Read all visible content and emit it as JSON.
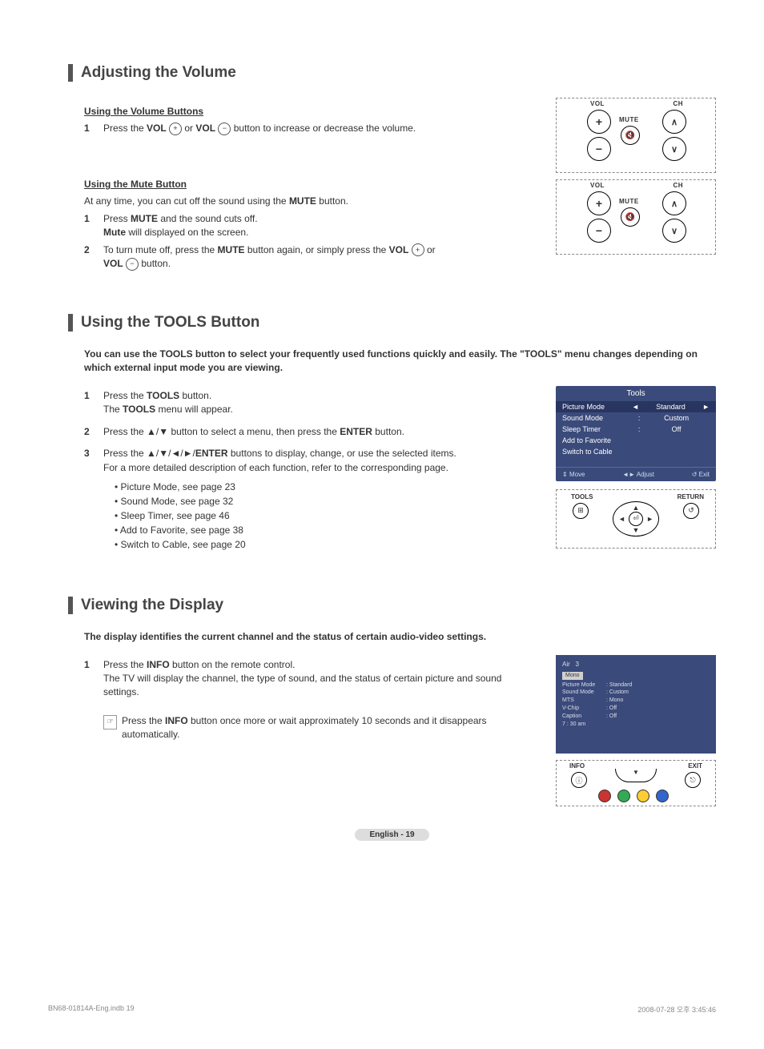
{
  "section1": {
    "title": "Adjusting the Volume",
    "sub1": "Using the Volume Buttons",
    "step1_pre": "Press the ",
    "vol": "VOL",
    "step1_mid": " or ",
    "step1_post": " button to increase or decrease the volume.",
    "sub2": "Using the Mute Button",
    "sub2_intro_pre": "At any time, you can cut off the sound using the ",
    "mute": "MUTE",
    "sub2_intro_post": " button.",
    "step2a_pre": "Press ",
    "step2a_mid": " and the sound cuts off.",
    "step2a_note_pre": "",
    "mute_cap": "Mute",
    "step2a_note_post": " will displayed on the screen.",
    "step2b_pre": "To turn mute off, press the ",
    "step2b_mid": " button again, or simply press the ",
    "step2b_or": " or ",
    "step2b_post": " button.",
    "remote": {
      "vol": "VOL",
      "ch": "CH",
      "mute": "MUTE"
    }
  },
  "section2": {
    "title": "Using the TOOLS Button",
    "intro": "You can use the TOOLS button to select your frequently used functions quickly and easily. The \"TOOLS\" menu changes depending on which external input mode you are viewing.",
    "step1_pre": "Press the ",
    "tools": "TOOLS",
    "step1_post": " button.",
    "step1_line2_pre": "The ",
    "step1_line2_post": " menu will appear.",
    "step2": "Press the ▲/▼ button to select a menu, then press the ",
    "enter": "ENTER",
    "step2_post": " button.",
    "step3_pre": "Press the ▲/▼/◄/►/",
    "step3_post": " buttons to display, change, or use the selected items.",
    "step3_line2": "For a more detailed description of each function, refer to the corresponding page.",
    "bullets": [
      "• Picture Mode, see page 23",
      "• Sound Mode, see page 32",
      "• Sleep Timer, see page 46",
      "• Add to Favorite, see page 38",
      "• Switch to Cable, see page 20"
    ],
    "menu": {
      "title": "Tools",
      "rows": [
        {
          "name": "Picture Mode",
          "val": "Standard",
          "selected": true
        },
        {
          "name": "Sound Mode",
          "val": "Custom"
        },
        {
          "name": "Sleep Timer",
          "val": "Off"
        },
        {
          "name": "Add to Favorite",
          "val": ""
        },
        {
          "name": "Switch to Cable",
          "val": ""
        }
      ],
      "footer": {
        "move": "Move",
        "adjust": "Adjust",
        "exit": "Exit"
      }
    },
    "nav": {
      "tools": "TOOLS",
      "return": "RETURN"
    }
  },
  "section3": {
    "title": "Viewing the Display",
    "intro": "The display identifies the current channel and the status of certain audio-video settings.",
    "step1_pre": "Press the ",
    "info": "INFO",
    "step1_post": " button on the remote control.",
    "step1_line2": "The TV will display the channel, the type of sound, and the status of certain picture and sound settings.",
    "note_pre": "Press the ",
    "note_post": " button once more or wait approximately 10 seconds and it disappears automatically.",
    "osd": {
      "air": "Air",
      "ch": "3",
      "mono": "Mono",
      "rows": [
        {
          "k": "Picture Mode",
          "v": ": Standard"
        },
        {
          "k": "Sound Mode",
          "v": ": Custom"
        },
        {
          "k": "MTS",
          "v": ": Mono"
        },
        {
          "k": "V-Chip",
          "v": ": Off"
        },
        {
          "k": "Caption",
          "v": ": Off"
        }
      ],
      "time": "7 : 30 am"
    },
    "panel": {
      "info": "INFO",
      "exit": "EXIT"
    }
  },
  "page_num": "English - 19",
  "footer": {
    "left": "BN68-01814A-Eng.indb   19",
    "right": "2008-07-28   오후 3:45:46"
  }
}
